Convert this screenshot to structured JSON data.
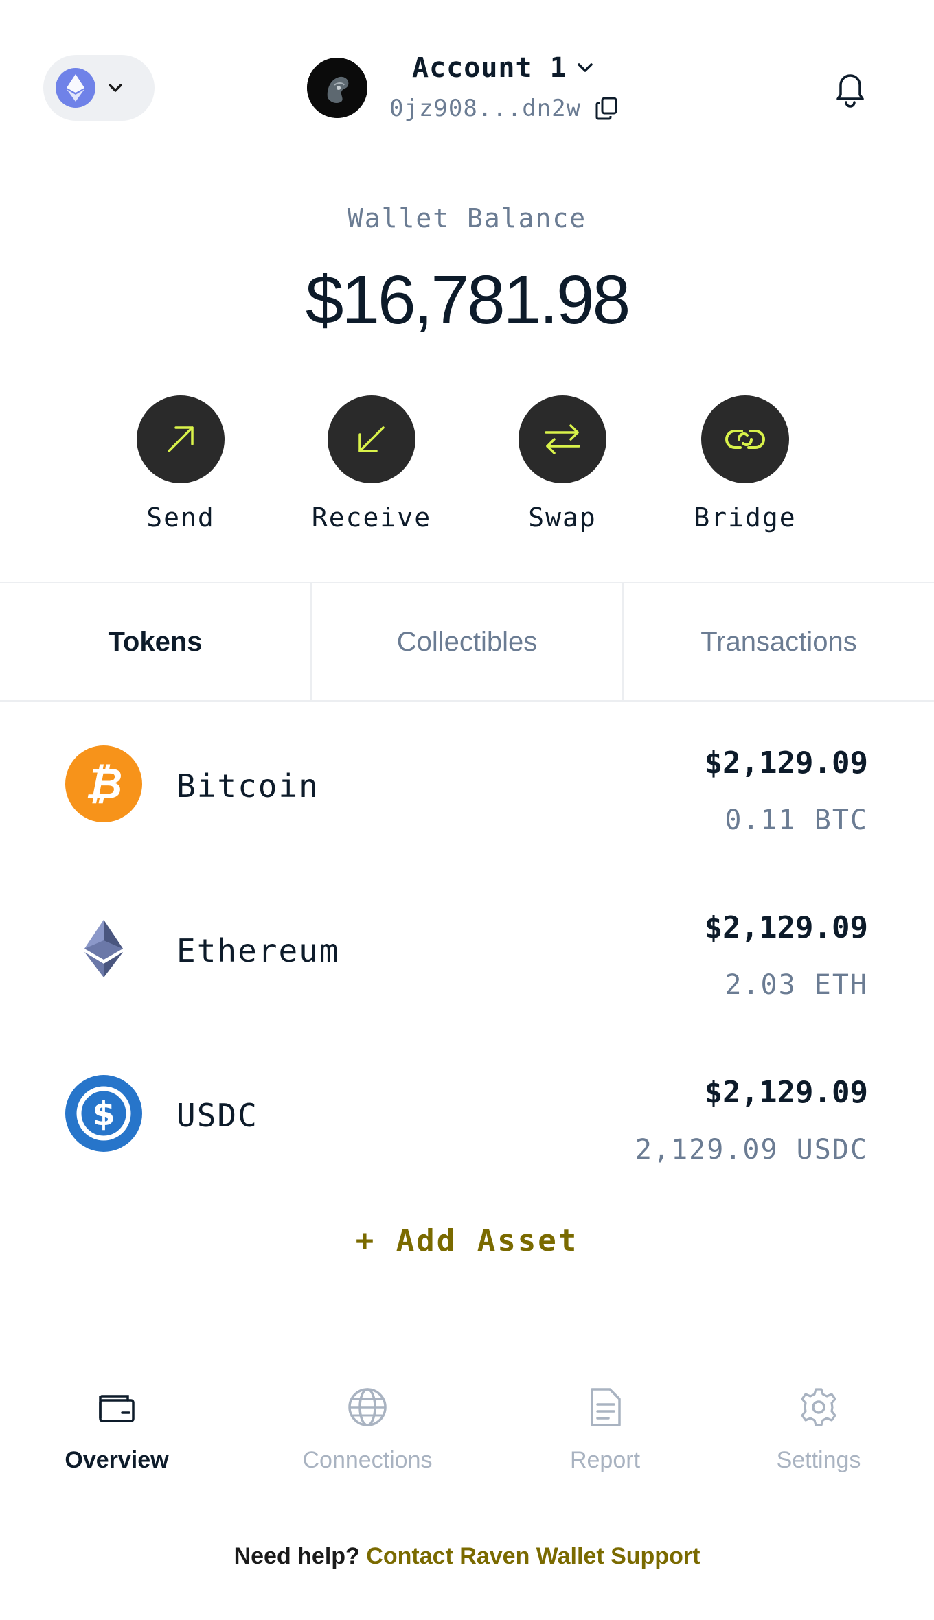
{
  "header": {
    "network_icon": "ethereum-icon",
    "account_name": "Account 1",
    "account_address": "0jz908...dn2w"
  },
  "balance": {
    "label": "Wallet Balance",
    "value": "$16,781.98"
  },
  "actions": [
    {
      "label": "Send",
      "icon": "arrow-up-right-icon"
    },
    {
      "label": "Receive",
      "icon": "arrow-down-left-icon"
    },
    {
      "label": "Swap",
      "icon": "swap-arrows-icon"
    },
    {
      "label": "Bridge",
      "icon": "link-icon"
    }
  ],
  "tabs": [
    {
      "label": "Tokens",
      "active": true
    },
    {
      "label": "Collectibles",
      "active": false
    },
    {
      "label": "Transactions",
      "active": false
    }
  ],
  "tokens": [
    {
      "name": "Bitcoin",
      "usd": "$2,129.09",
      "amount": "0.11 BTC",
      "icon": "bitcoin-icon",
      "color": "#f7931a"
    },
    {
      "name": "Ethereum",
      "usd": "$2,129.09",
      "amount": "2.03 ETH",
      "icon": "ethereum-icon",
      "color": "#627eea"
    },
    {
      "name": "USDC",
      "usd": "$2,129.09",
      "amount": "2,129.09 USDC",
      "icon": "usdc-icon",
      "color": "#2775ca"
    }
  ],
  "add_asset_label": "+ Add Asset",
  "nav": [
    {
      "label": "Overview",
      "icon": "wallet-icon",
      "active": true
    },
    {
      "label": "Connections",
      "icon": "globe-icon",
      "active": false
    },
    {
      "label": "Report",
      "icon": "document-icon",
      "active": false
    },
    {
      "label": "Settings",
      "icon": "gear-icon",
      "active": false
    }
  ],
  "help": {
    "prefix": "Need help?",
    "link": "Contact Raven Wallet Support"
  },
  "colors": {
    "accent": "#d9f24a",
    "link": "#7a6a00",
    "action_bg": "#2a2a2a"
  }
}
